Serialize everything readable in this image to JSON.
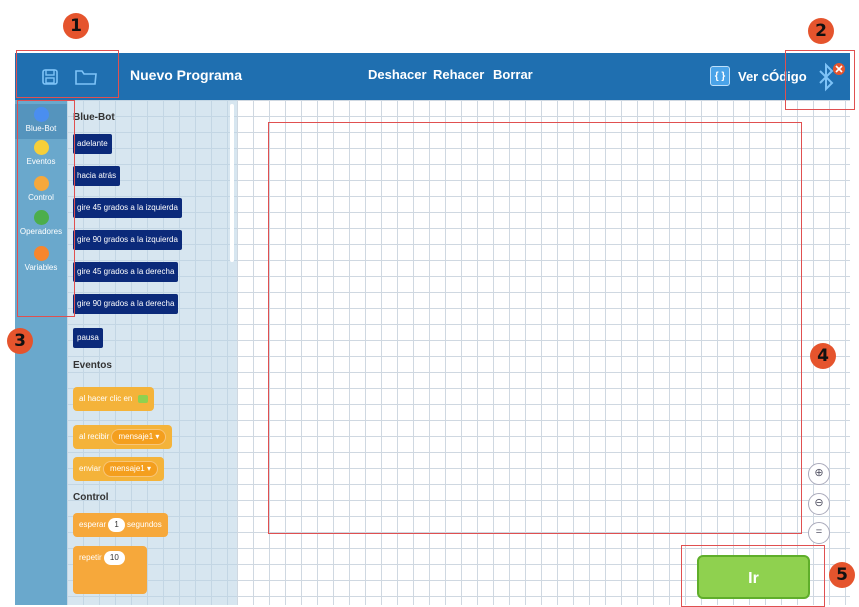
{
  "annotations": {
    "b1": "1",
    "b2": "2",
    "b3": "3",
    "b4": "4",
    "b5": "5"
  },
  "toolbar": {
    "title": "Nuevo Programa",
    "undo": "Deshacer",
    "redo": "Rehacer",
    "clear": "Borrar",
    "view_code": "Ver cÓdigo"
  },
  "categories": [
    "Blue-Bot",
    "Eventos",
    "Control",
    "Operadores",
    "Variables"
  ],
  "category_colors": [
    "#4a8ef0",
    "#f7cf3a",
    "#f6a83b",
    "#4cae4c",
    "#f7862e"
  ],
  "palette": {
    "sec_bluebot": "Blue-Bot",
    "forward": "adelante",
    "back": "hacia atrás",
    "l45": "gire 45 grados a la izquierda",
    "l90": "gire 90 grados a la izquierda",
    "r45": "gire 45 grados a la derecha",
    "r90": "gire 90 grados a la derecha",
    "pause": "pausa",
    "sec_events": "Eventos",
    "on_click": "al hacer clic en",
    "on_receive": "al recibir",
    "msg1": "mensaje1",
    "send": "enviar",
    "msg2": "mensaje1",
    "sec_control": "Control",
    "wait": "esperar",
    "wait_n": "1",
    "seconds": "segundos",
    "repeat": "repetir",
    "repeat_n": "10"
  },
  "go_button": "Ir"
}
